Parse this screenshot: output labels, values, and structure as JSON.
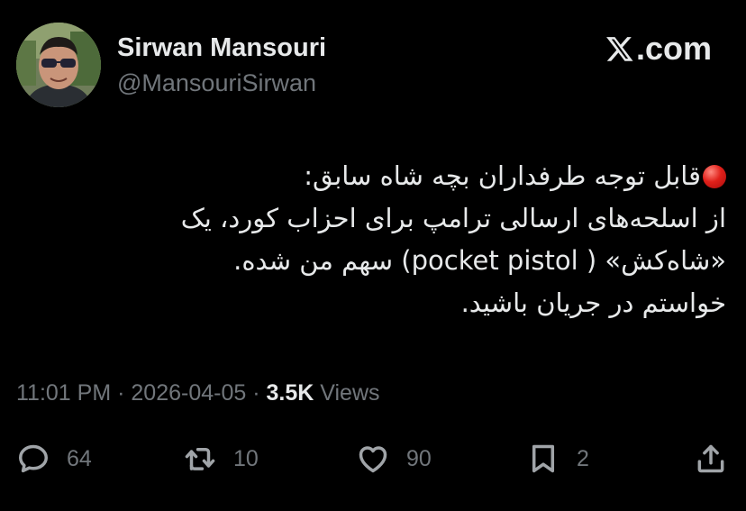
{
  "author": {
    "name": "Sirwan Mansouri",
    "handle": "@MansouriSirwan"
  },
  "brand": {
    "label": ".com"
  },
  "tweet": {
    "lines": [
      "قابل توجه طرفداران بچه شاه سابق:",
      "از اسلحه‌های ارسالی ترامپ برای احزاب کورد، یک",
      "«شاه‌کش» ( pocket pistol) سهم من شده.",
      "خواستم در جریان باشید."
    ]
  },
  "meta": {
    "time": "11:01 PM",
    "date": "2026-04-05",
    "separator": "·",
    "views_count": "3.5K",
    "views_label": "Views"
  },
  "actions": {
    "replies": "64",
    "retweets": "10",
    "likes": "90",
    "bookmarks": "2"
  },
  "icons": {
    "brand": "x-logo-icon",
    "reply": "reply-icon",
    "retweet": "retweet-icon",
    "like": "heart-icon",
    "bookmark": "bookmark-icon",
    "share": "share-icon"
  },
  "colors": {
    "background": "#000000",
    "text": "#e7e9ea",
    "secondary": "#71767b",
    "dot": "#e0201a"
  }
}
